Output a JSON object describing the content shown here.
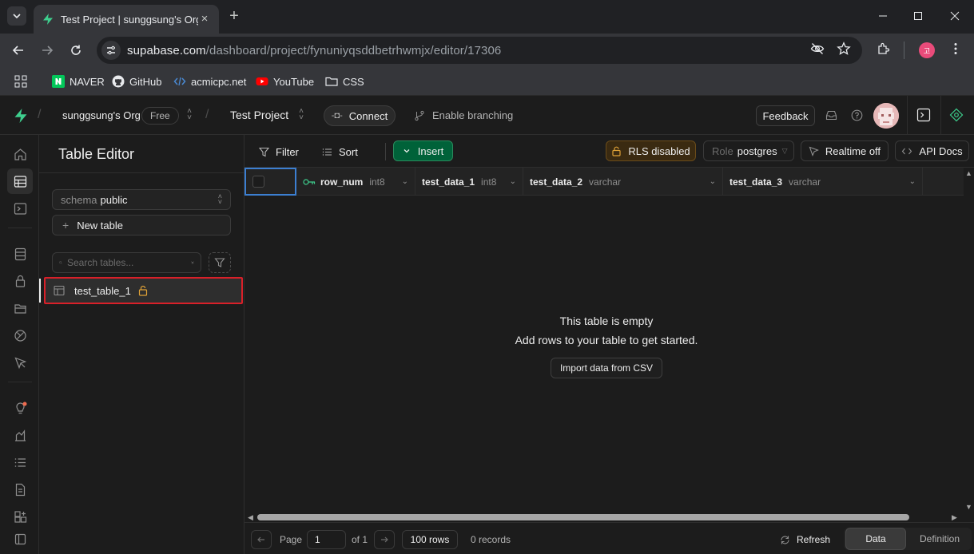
{
  "browser": {
    "tab_title": "Test Project | sunggsung's Org",
    "url_host": "supabase.com",
    "url_path": "/dashboard/project/fynuniyqsddbetrhwmjx/editor/17306",
    "profile_initial": "고",
    "bookmarks": [
      {
        "label": "NAVER",
        "icon": "naver-icon"
      },
      {
        "label": "GitHub",
        "icon": "github-icon"
      },
      {
        "label": "acmicpc.net",
        "icon": "code-icon"
      },
      {
        "label": "YouTube",
        "icon": "youtube-icon"
      },
      {
        "label": "CSS",
        "icon": "folder-icon"
      }
    ]
  },
  "header": {
    "org_name": "sunggsung's Org",
    "plan_badge": "Free",
    "project_name": "Test Project",
    "connect_label": "Connect",
    "branching_label": "Enable branching",
    "feedback_label": "Feedback"
  },
  "sidebar": {
    "title": "Table Editor",
    "schema_key": "schema",
    "schema_value": "public",
    "new_table_label": "New table",
    "search_placeholder": "Search tables...",
    "tables": [
      {
        "name": "test_table_1",
        "locked": true
      }
    ]
  },
  "grid_toolbar": {
    "filter_label": "Filter",
    "sort_label": "Sort",
    "insert_label": "Insert",
    "rls_label": "RLS disabled",
    "role_key": "Role",
    "role_value": "postgres",
    "realtime_label": "Realtime off",
    "api_docs_label": "API Docs"
  },
  "columns": [
    {
      "name": "row_num",
      "type": "int8",
      "primary_key": true
    },
    {
      "name": "test_data_1",
      "type": "int8"
    },
    {
      "name": "test_data_2",
      "type": "varchar"
    },
    {
      "name": "test_data_3",
      "type": "varchar"
    }
  ],
  "empty_state": {
    "title": "This table is empty",
    "subtitle": "Add rows to your table to get started.",
    "import_label": "Import data from CSV"
  },
  "footer": {
    "page_label": "Page",
    "page_value": "1",
    "of_label": "of 1",
    "rows_label": "100 rows",
    "records_label": "0 records",
    "refresh_label": "Refresh",
    "view_tabs": [
      "Data",
      "Definition"
    ],
    "active_view": "Data"
  },
  "colors": {
    "accent_green": "#3ecf8e",
    "insert_bg": "#006239",
    "rls_warning": "#e0a237",
    "highlight_red": "#d92029",
    "selection_blue": "#3c7fd1"
  }
}
